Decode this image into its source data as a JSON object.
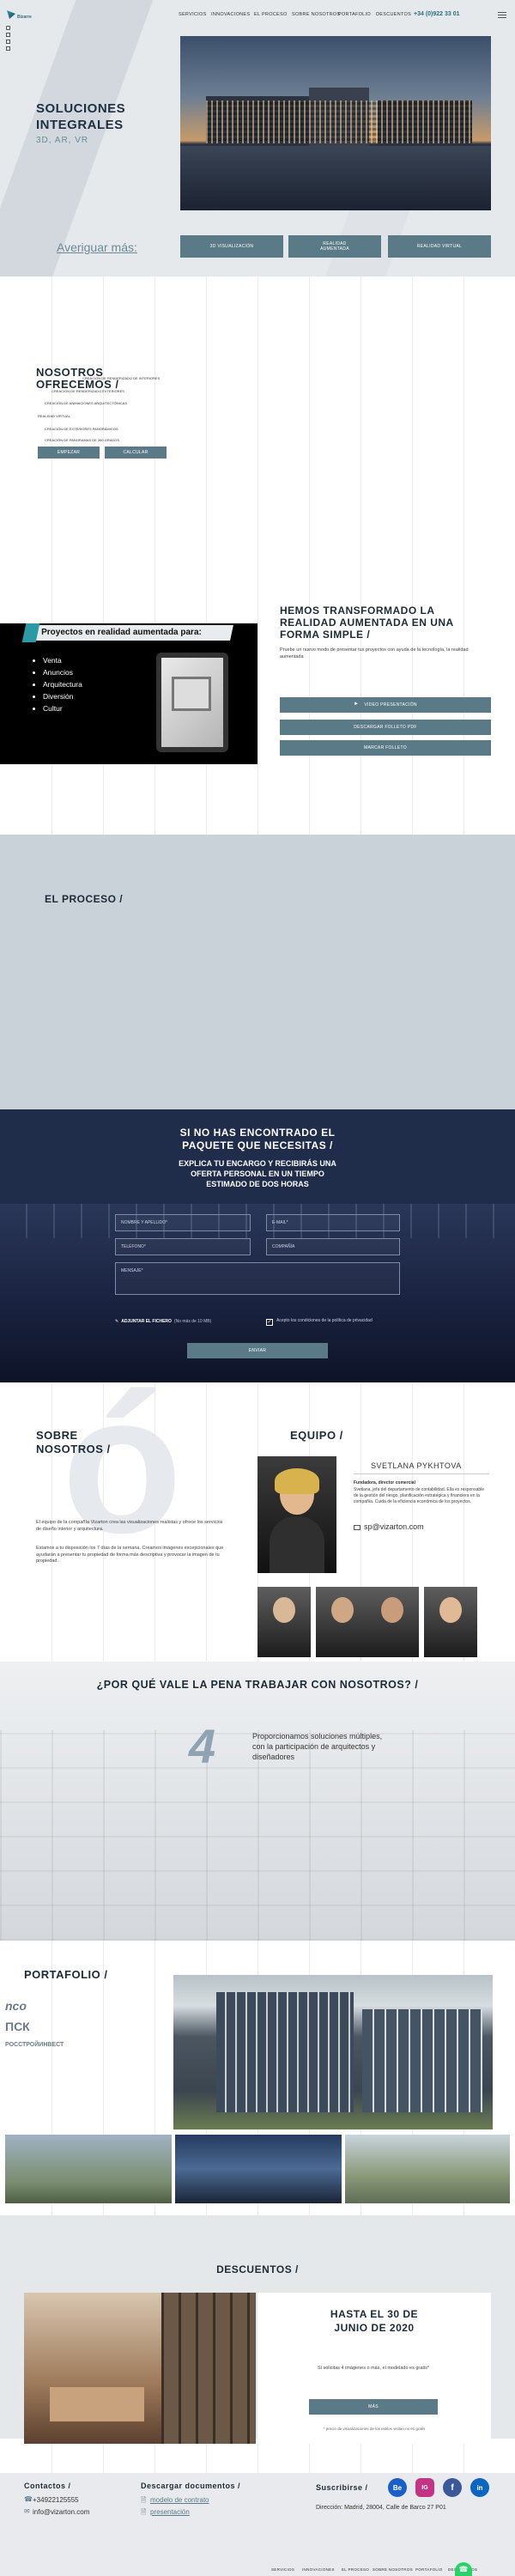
{
  "nav": {
    "logo": "Bizarre",
    "items": [
      "SERVICIOS",
      "INNOVACIONES",
      "EL PROCESO",
      "SOBRE NOSOTROS",
      "PORTAFOLIO",
      "DESCUENTOS"
    ],
    "phone": "+34 (0)922 33 01"
  },
  "hero": {
    "title_line1": "SOLUCIONES",
    "title_line2": "INTEGRALES",
    "subtitle": "3D, AR, VR",
    "more_label": "Averiguar más:",
    "buttons": [
      "3D VISUALIZACIÓN",
      "REALIDAD AUMENTADA",
      "REALIDAD VIRTUAL"
    ]
  },
  "offer": {
    "title_line1": "NOSOTROS",
    "title_line2": "OFRECEMOS /",
    "items": [
      "CREACIÓN DE RENDERIZADO DE INTERIORES",
      "CREACIÓN DE RENDERIZADO EXTERIORES",
      "CREACIÓN DE ANIMACIONES ARQUITECTÓNICAS",
      "REALIDAD VIRTUAL",
      "CREACIÓN DE EXTERIORES PANORÁMICOS",
      "CREACIÓN DE PANORAMAS DE 360 GRADOS"
    ],
    "buttons": [
      "EMPEZAR",
      "CALCULAR"
    ]
  },
  "ar": {
    "banner": "Proyectos en realidad aumentada para:",
    "list": [
      "Venta",
      "Anuncios",
      "Arquitectura",
      "Diversión",
      "Cultur"
    ],
    "title_line1": "HEMOS TRANSFORMADO LA",
    "title_line2": "REALIDAD AUMENTADA EN UNA",
    "title_line3": "FORMA SIMPLE /",
    "text": "Pruebe un nuevo modo de presentar tus proyectos con ayuda de la tecnología, la realidad aumentada",
    "buttons": [
      "VIDEO PRESENTACIÓN",
      "DESCARGAR FOLLETO PDF",
      "MARCAR FOLLETO"
    ]
  },
  "process": {
    "title": "EL PROCESO /"
  },
  "form": {
    "title_line1": "SI NO HAS ENCONTRADO EL",
    "title_line2": "PAQUETE QUE NECESITAS /",
    "sub_line1": "EXPLICA TU ENCARGO Y RECIBIRÁS UNA",
    "sub_line2": "OFERTA PERSONAL EN UN TIEMPO",
    "sub_line3": "ESTIMADO DE DOS HORAS",
    "fields": [
      "NOMBRE Y APELLIDO*",
      "E-MAIL*",
      "TELÉFONO*",
      "COMPAÑÍA",
      "MENSAJE*"
    ],
    "attach": "ADJUNTAR EL FICHERO",
    "attach_note": "(No más de 10 MB)",
    "consent": "Acepto los condiciones de la política de privacidad",
    "submit": "ENVIAR"
  },
  "about": {
    "title_line1": "SOBRE",
    "title_line2": "NOSOTROS /",
    "big_letter": "ó",
    "p1": "El equipo de la compañía Vizarton crea las visualizaciones realistas y ofrece los servicios de diseño interior y arquitectura.",
    "p2": "Estamos a tu disposición los 7 días de la semana. Creamos imágenes excepcionales que ayudarán a presentar tu propiedad de forma más descriptiva y provocar la imagen de tu propiedad."
  },
  "team": {
    "title": "EQUIPO /",
    "name": "SVETLANA PYKHTOVA",
    "role": "Fundadora, director comercial",
    "desc": "Svetlana, jefa del departamento de contabilidad. Ella es responsable de la gestión del riesgo, planificación estratégica y financiera en la compañía. Cuida de la eficiencia económica de los proyectos.",
    "email": "sp@vizarton.com"
  },
  "why": {
    "title": "¿POR QUÉ VALE LA PENA TRABAJAR CON NOSOTROS? /",
    "number": "4",
    "text_line1": "Proporcionamos soluciones múltiples,",
    "text_line2": "con la participación de arquitectos y",
    "text_line3": "diseñadores"
  },
  "portfolio": {
    "title": "PORTAFOLIO /",
    "clients": [
      "nco",
      "ПСК",
      "РОССТРОЙИНВЕСТ"
    ]
  },
  "discounts": {
    "title": "DESCUENTOS /",
    "offer_line1": "HASTA EL 30 DE",
    "offer_line2": "JUNIO DE 2020",
    "desc": "Si solicitas 4 imágenes o más, el modelado es gratis*",
    "button": "MÁS",
    "note": "* precio de visualizaciones de los estilos visitan no es gratis"
  },
  "footer": {
    "contacts_title": "Contactos /",
    "phone": "+34922125555",
    "email": "info@vizarton.com",
    "docs_title": "Descargar documentos /",
    "docs": [
      "modelo de contrato",
      "presentación"
    ],
    "subscribe": "Suscribirse /",
    "social": [
      "Be",
      "IG",
      "f",
      "in"
    ],
    "address": "Dirección: Madrid, 28004, Calle de Barco 27 P01",
    "nav": [
      "SERVICIOS",
      "INNOVACIONES",
      "EL PROCESO",
      "SOBRE NOSOTROS",
      "PORTAFOLIO",
      "DESCUENTOS"
    ]
  },
  "colors": {
    "accent": "#5a7a87",
    "dark": "#1f2c4a",
    "teal": "#2b6f7e"
  }
}
